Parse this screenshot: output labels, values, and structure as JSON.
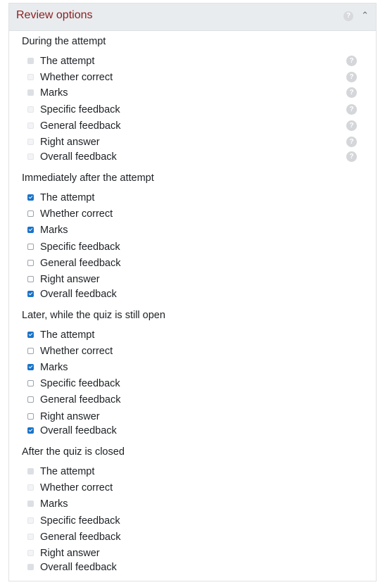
{
  "header": {
    "title": "Review options",
    "help_icon_glyph": "?",
    "chevron_glyph": "^"
  },
  "help_glyph": "?",
  "sections": [
    {
      "title": "During the attempt",
      "disabled": true,
      "show_help": true,
      "options": [
        {
          "label": "The attempt",
          "checked": true
        },
        {
          "label": "Whether correct",
          "checked": false
        },
        {
          "label": "Marks",
          "checked": true
        },
        {
          "label": "Specific feedback",
          "checked": false
        },
        {
          "label": "General feedback",
          "checked": false
        },
        {
          "label": "Right answer",
          "checked": false
        },
        {
          "label": "Overall feedback",
          "checked": false
        }
      ]
    },
    {
      "title": "Immediately after the attempt",
      "disabled": false,
      "show_help": false,
      "options": [
        {
          "label": "The attempt",
          "checked": true
        },
        {
          "label": "Whether correct",
          "checked": false
        },
        {
          "label": "Marks",
          "checked": true
        },
        {
          "label": "Specific feedback",
          "checked": false
        },
        {
          "label": "General feedback",
          "checked": false
        },
        {
          "label": "Right answer",
          "checked": false
        },
        {
          "label": "Overall feedback",
          "checked": true
        }
      ]
    },
    {
      "title": "Later, while the quiz is still open",
      "disabled": false,
      "show_help": false,
      "options": [
        {
          "label": "The attempt",
          "checked": true
        },
        {
          "label": "Whether correct",
          "checked": false
        },
        {
          "label": "Marks",
          "checked": true
        },
        {
          "label": "Specific feedback",
          "checked": false
        },
        {
          "label": "General feedback",
          "checked": false
        },
        {
          "label": "Right answer",
          "checked": false
        },
        {
          "label": "Overall feedback",
          "checked": true
        }
      ]
    },
    {
      "title": "After the quiz is closed",
      "disabled": true,
      "show_help": false,
      "options": [
        {
          "label": "The attempt",
          "checked": true
        },
        {
          "label": "Whether correct",
          "checked": false
        },
        {
          "label": "Marks",
          "checked": true
        },
        {
          "label": "Specific feedback",
          "checked": false
        },
        {
          "label": "General feedback",
          "checked": false
        },
        {
          "label": "Right answer",
          "checked": false
        },
        {
          "label": "Overall feedback",
          "checked": true
        }
      ]
    }
  ]
}
